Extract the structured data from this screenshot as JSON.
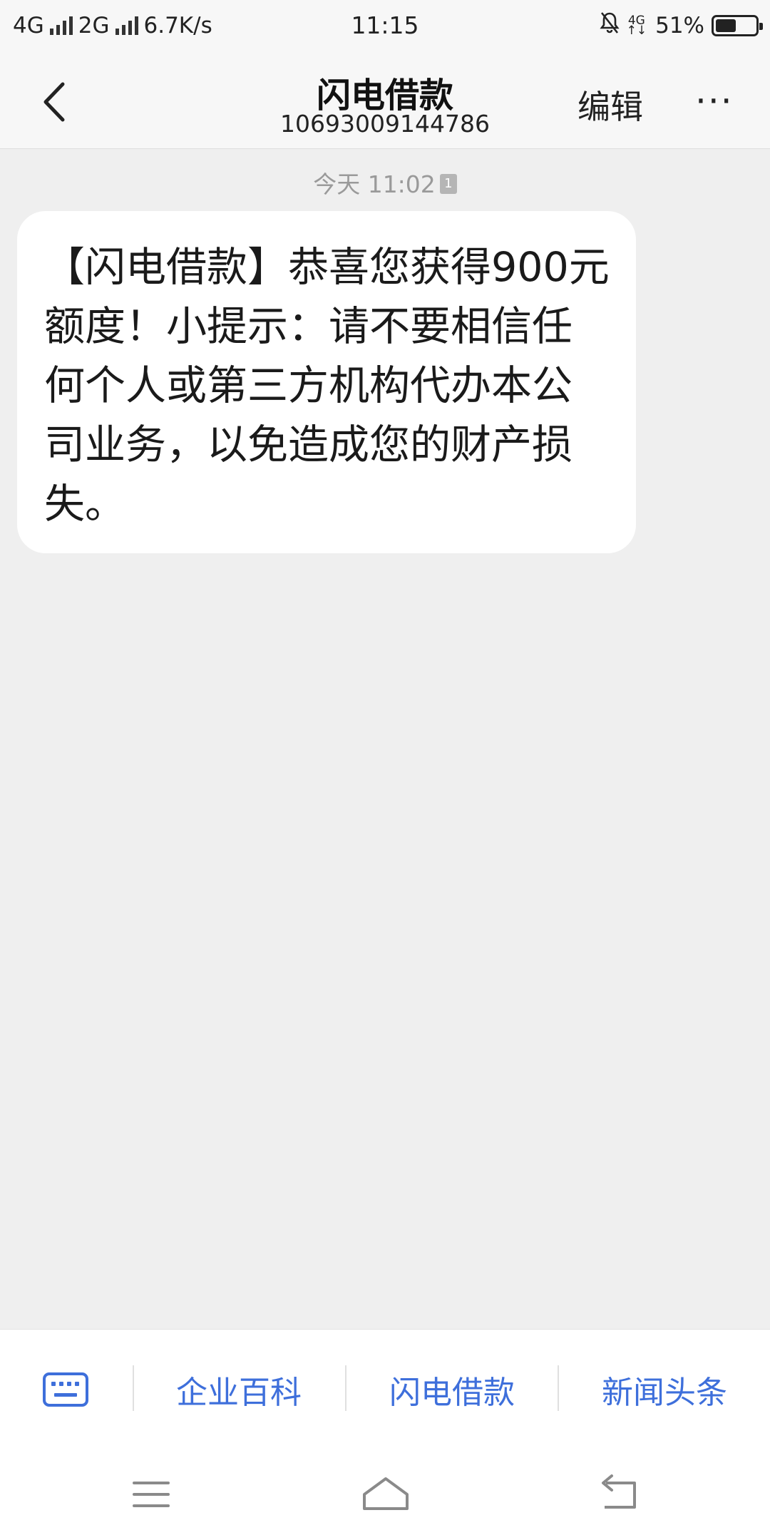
{
  "status_bar": {
    "sim1": "4G",
    "sim2": "2G",
    "speed": "6.7K/s",
    "time": "11:15",
    "net_label_top": "4G",
    "net_label_bottom": "↑↓",
    "battery": "51%",
    "battery_level": 0.51
  },
  "header": {
    "title": "闪电借款",
    "number": "10693009144786",
    "edit_label": "编辑",
    "more_label": "···"
  },
  "conversation": {
    "date": "今天 11:02",
    "sim_badge": "1",
    "message": "【闪电借款】恭喜您获得900元额度！小提示：请不要相信任何个人或第三方机构代办本公司业务，以免造成您的财产损失。"
  },
  "bottom_menu": {
    "items": [
      "企业百科",
      "闪电借款",
      "新闻头条"
    ]
  },
  "colors": {
    "accent": "#3e6fdb",
    "background": "#efefef",
    "bubble": "#ffffff"
  },
  "icons": {
    "back": "chevron-left-icon",
    "keyboard": "keyboard-icon",
    "nav_menu": "menu-icon",
    "nav_home": "home-icon",
    "nav_back": "back-icon"
  }
}
